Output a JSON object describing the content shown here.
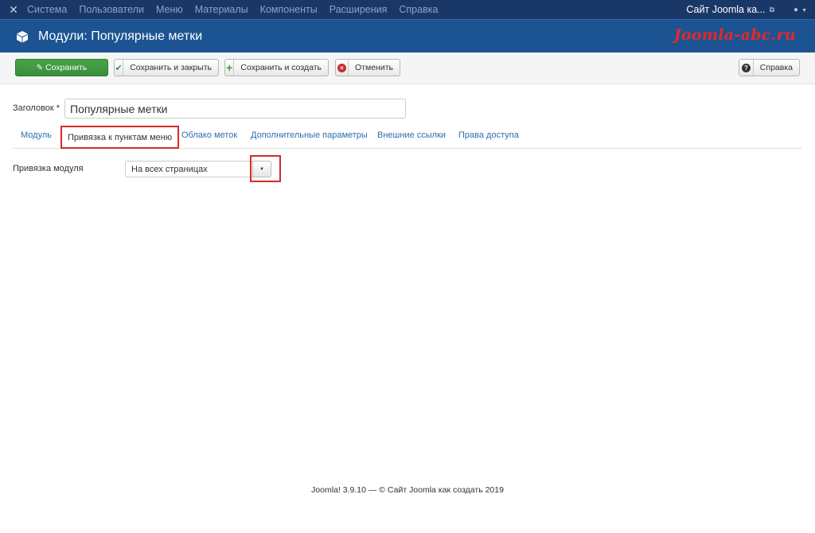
{
  "topnav": {
    "menu": [
      "Система",
      "Пользователи",
      "Меню",
      "Материалы",
      "Компоненты",
      "Расширения",
      "Справка"
    ],
    "site_link": "Сайт Joomla ка..."
  },
  "header": {
    "title": "Модули: Популярные метки",
    "brand": "Joomla-abc.ru"
  },
  "toolbar": {
    "save": "Сохранить",
    "save_close": "Сохранить и закрыть",
    "save_new": "Сохранить и создать",
    "cancel": "Отменить",
    "help": "Справка"
  },
  "form": {
    "title_label": "Заголовок *",
    "title_value": "Популярные метки"
  },
  "tabs": [
    "Модуль",
    "Привязка к пунктам меню",
    "Облако меток",
    "Дополнительные параметры",
    "Внешние ссылки",
    "Права доступа"
  ],
  "active_tab": "Привязка к пунктам меню",
  "assignment": {
    "label": "Привязка модуля",
    "selected": "На всех страницах"
  },
  "footer": "Joomla! 3.9.10  —  © Сайт Joomla как создать 2019",
  "colors": {
    "navbar": "#1a3867",
    "header": "#1c5493",
    "save_green": "#47a447",
    "highlight_red": "#d42a2a",
    "link_blue": "#2a6fb0"
  }
}
